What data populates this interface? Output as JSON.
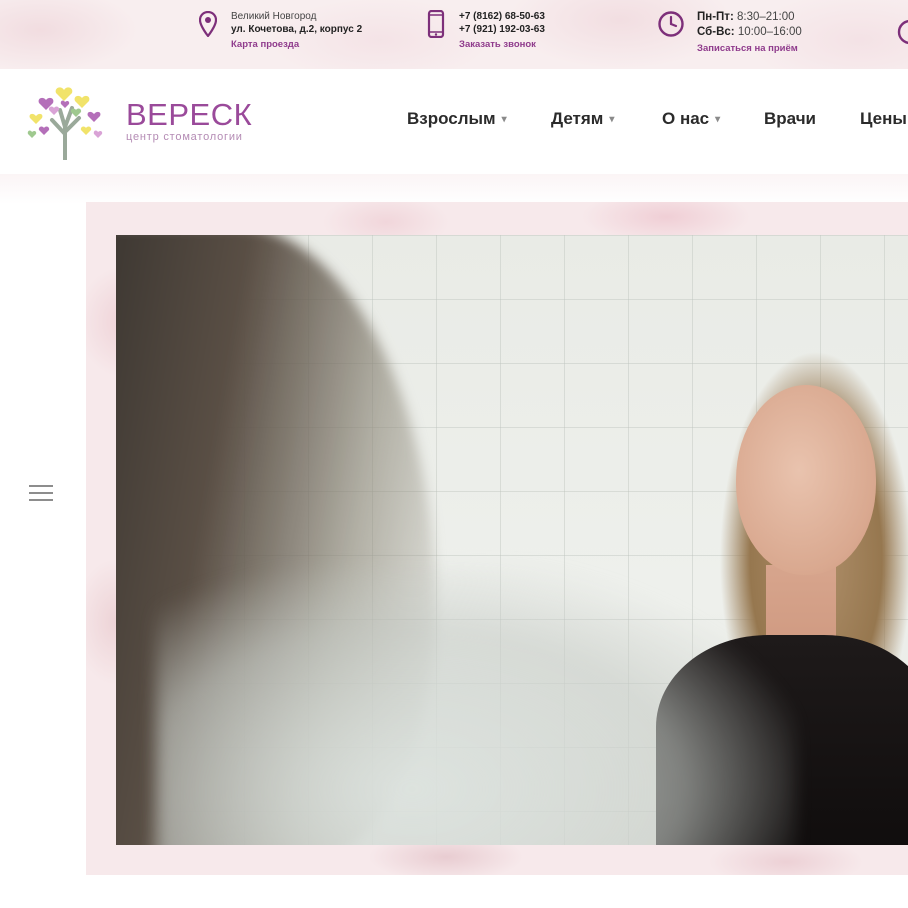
{
  "topbar": {
    "address": {
      "city": "Великий Новгород",
      "street": "ул. Кочетова, д.2, корпус 2",
      "link": "Карта проезда"
    },
    "phone": {
      "phone1": "+7 (8162) 68-50-63",
      "phone2": "+7 (921) 192-03-63",
      "link": "Заказать звонок"
    },
    "hours": {
      "weekdays_label": "Пн-Пт:",
      "weekdays_time": " 8:30–21:00",
      "weekend_label": "Сб-Вс:",
      "weekend_time": " 10:00–16:00",
      "link": "Записаться на приём"
    },
    "icon_color": "#7d2f7a",
    "link_color": "#8f3b8c"
  },
  "header": {
    "brand_name": "ВЕРЕСК",
    "brand_sub": "центр стоматологии",
    "brand_color": "#9a4a9a",
    "nav": [
      {
        "label": "Взрослым",
        "has_dropdown": true
      },
      {
        "label": "Детям",
        "has_dropdown": true
      },
      {
        "label": "О нас",
        "has_dropdown": true
      },
      {
        "label": "Врачи",
        "has_dropdown": false
      },
      {
        "label": "Цены",
        "has_dropdown": false
      }
    ],
    "caret": "▾"
  },
  "icons": {
    "location": "map-pin-icon",
    "phone": "mobile-phone-icon",
    "clock": "clock-icon",
    "menu": "hamburger-menu-icon"
  }
}
